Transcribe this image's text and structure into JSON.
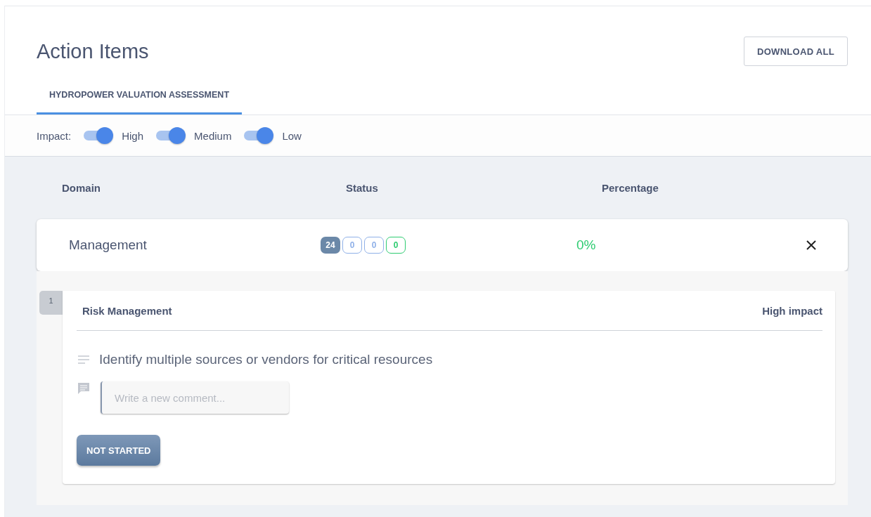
{
  "page": {
    "title": "Action Items",
    "download_button": "DOWNLOAD ALL"
  },
  "tabs": [
    {
      "label": "HYDROPOWER VALUATION ASSESSMENT",
      "selected": true
    }
  ],
  "impact_filter": {
    "label": "Impact:",
    "toggles": [
      {
        "label": "High",
        "on": true
      },
      {
        "label": "Medium",
        "on": true
      },
      {
        "label": "Low",
        "on": true
      }
    ]
  },
  "table": {
    "columns": [
      "Domain",
      "Status",
      "Percentage"
    ],
    "rows": [
      {
        "domain": "Management",
        "expanded": true,
        "percentage": "0%",
        "status_counts": [
          {
            "value": "24",
            "kind": "filled",
            "color": "#6b88a8"
          },
          {
            "value": "0",
            "kind": "outline",
            "color": "#8fb0e8"
          },
          {
            "value": "0",
            "kind": "outline",
            "color": "#8fb0e8"
          },
          {
            "value": "0",
            "kind": "outline",
            "color": "#2ecc71"
          }
        ],
        "items": [
          {
            "number": "1",
            "category": "Risk Management",
            "impact": "High impact",
            "text": "Identify multiple sources or vendors for critical resources",
            "comment_placeholder": "Write a new comment...",
            "status_button": "NOT STARTED"
          }
        ]
      }
    ]
  }
}
